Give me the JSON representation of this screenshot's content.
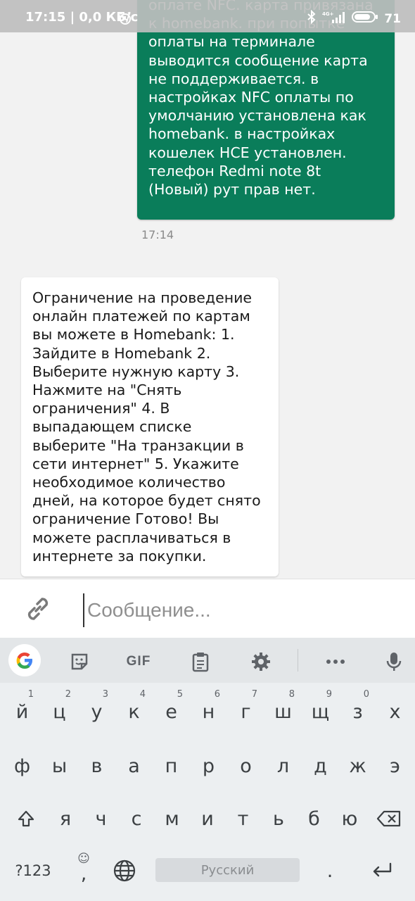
{
  "status_bar": {
    "time_and_speed": "17:15 | 0,0 КБ/с",
    "battery": "71"
  },
  "chat": {
    "outgoing_message": "оплате NFC. карта привязана к homebank. при попытке оплаты на терминале выводится сообщение карта не поддерживается. в настройках NFC оплаты по умолчанию установлена как homebank. в настройках кошелек HCE установлен. телефон Redmi note 8t (Новый) рут прав нет.",
    "outgoing_time": "17:14",
    "incoming_message": "Ограничение на проведение онлайн платежей по картам вы можете в Homebank: 1. Зайдите в Homebank 2. Выберите нужную карту 3. Нажмите на \"Снять ограничения\" 4. В выпадающем списке выберите \"На транзакции в сети интернет\" 5. Укажите необходимое количество дней, на которое будет снято ограничение Готово! Вы можете расплачиваться в интернете за покупки."
  },
  "composer": {
    "placeholder": "Сообщение...",
    "attach_icon": "attach-link-icon"
  },
  "keyboard": {
    "toolbar": [
      "google-icon",
      "sticker-icon",
      "gif-icon",
      "clipboard-icon",
      "settings-icon",
      "more-icon",
      "mic-icon"
    ],
    "gif_label": "GIF",
    "row1": [
      {
        "key": "й",
        "hint": "1"
      },
      {
        "key": "ц",
        "hint": "2"
      },
      {
        "key": "у",
        "hint": "3"
      },
      {
        "key": "к",
        "hint": "4"
      },
      {
        "key": "е",
        "hint": "5"
      },
      {
        "key": "н",
        "hint": "6"
      },
      {
        "key": "г",
        "hint": "7"
      },
      {
        "key": "ш",
        "hint": "8"
      },
      {
        "key": "щ",
        "hint": "9"
      },
      {
        "key": "з",
        "hint": "0"
      },
      {
        "key": "х",
        "hint": ""
      }
    ],
    "row2": [
      "ф",
      "ы",
      "в",
      "а",
      "п",
      "р",
      "о",
      "л",
      "д",
      "ж",
      "э"
    ],
    "row3": [
      "я",
      "ч",
      "с",
      "м",
      "и",
      "т",
      "ь",
      "б",
      "ю"
    ],
    "symbols_label": "?123",
    "comma_label": ",",
    "space_label": "Русский",
    "period_label": "."
  },
  "colors": {
    "outgoing_bubble": "#0a7d5a",
    "incoming_bubble": "#ffffff",
    "chat_background": "#f2f2f2",
    "keyboard_background": "#eceff1"
  }
}
